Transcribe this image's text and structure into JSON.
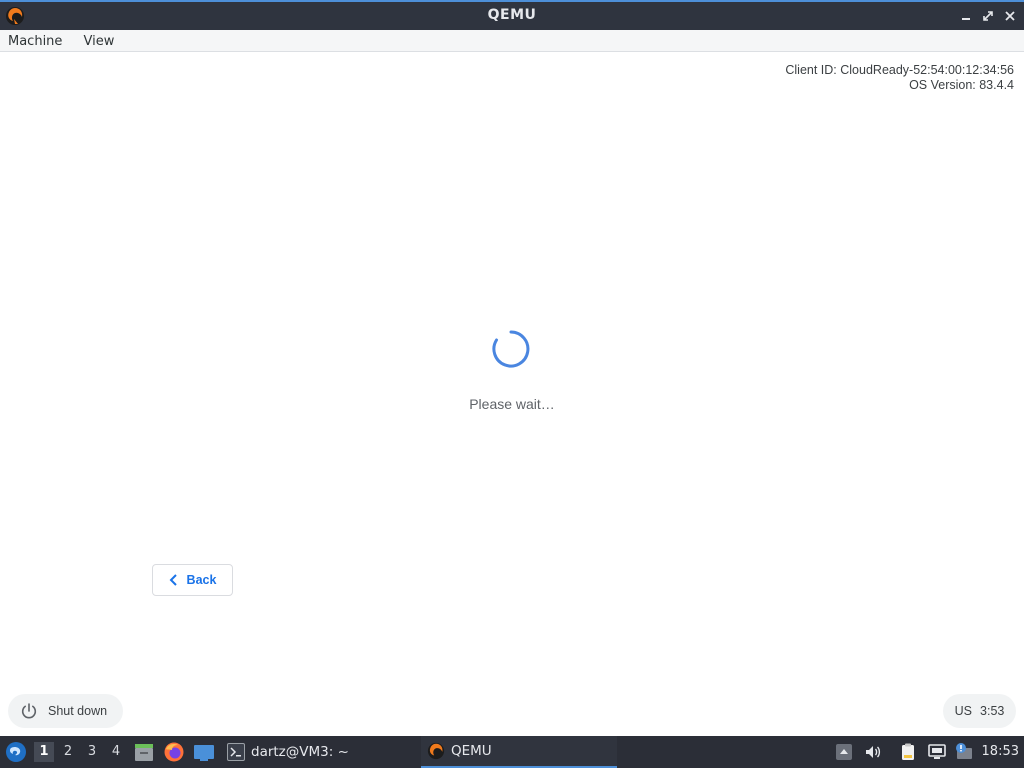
{
  "window": {
    "title": "QEMU",
    "controls": [
      "minimize-icon",
      "maximize-icon",
      "close-icon"
    ]
  },
  "menubar": {
    "items": [
      {
        "label": "Machine"
      },
      {
        "label": "View"
      }
    ]
  },
  "guest": {
    "client_id": "Client ID: CloudReady-52:54:00:12:34:56",
    "os_version": "OS Version: 83.4.4",
    "wait_text": "Please wait…",
    "back_label": "Back",
    "shutdown_label": "Shut down",
    "keyboard_layout": "US",
    "guest_time": "3:53",
    "accent_color": "#1a73e8"
  },
  "taskbar": {
    "workspaces": [
      "1",
      "2",
      "3",
      "4"
    ],
    "active_workspace": "1",
    "tasks": [
      {
        "label": "dartz@VM3: ~",
        "icon": "terminal-icon"
      },
      {
        "label": "QEMU",
        "icon": "qemu-icon",
        "active": true
      }
    ],
    "clock": "18:53"
  }
}
